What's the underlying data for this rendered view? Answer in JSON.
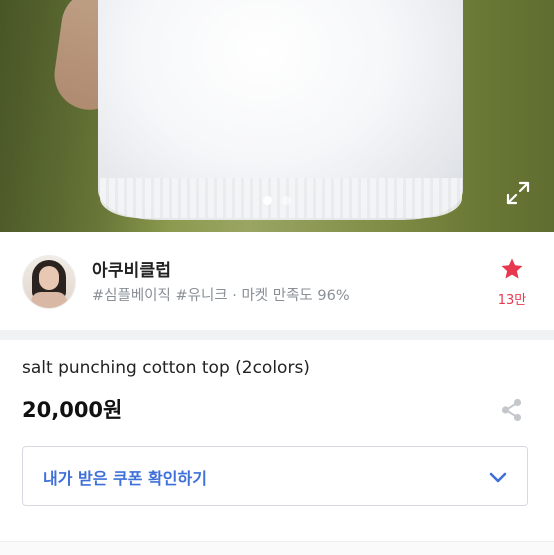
{
  "carousel": {
    "slide_count": 2,
    "active_index": 0
  },
  "shop": {
    "name": "아쿠비클럽",
    "tags": "#심플베이직 #유니크 · 마켓 만족도 96%",
    "favorite_count": "13만"
  },
  "product": {
    "title": "salt punching cotton top (2colors)",
    "price": "20,000원"
  },
  "coupon": {
    "label": "내가 받은 쿠폰 확인하기"
  },
  "colors": {
    "accent_blue": "#3f6fd8",
    "favorite_red": "#e8384f",
    "text_gray": "#8a8f96"
  },
  "icons": {
    "expand": "expand-icon",
    "favorite": "star-icon",
    "share": "share-icon",
    "chevron": "chevron-down-icon"
  }
}
